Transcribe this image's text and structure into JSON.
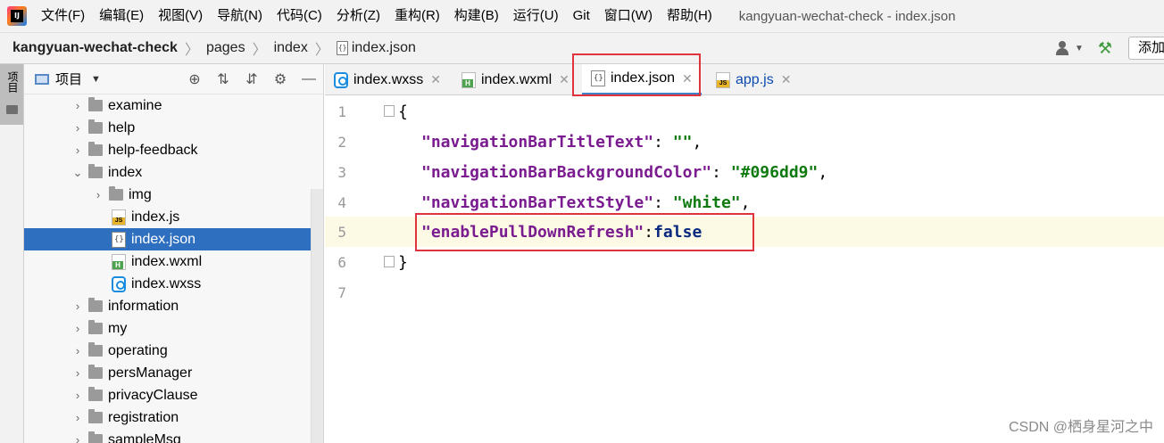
{
  "menubar": {
    "logo_icon": "jetbrains-ide-logo",
    "items": [
      "文件(F)",
      "编辑(E)",
      "视图(V)",
      "导航(N)",
      "代码(C)",
      "分析(Z)",
      "重构(R)",
      "构建(B)",
      "运行(U)",
      "Git",
      "窗口(W)",
      "帮助(H)"
    ],
    "window_title": "kangyuan-wechat-check - index.json"
  },
  "navbar": {
    "crumbs": [
      "kangyuan-wechat-check",
      "pages",
      "index",
      "index.json"
    ],
    "add_label": "添加"
  },
  "toolstrip": {
    "project_tab": "项目"
  },
  "project_panel": {
    "title": "项目",
    "tree": [
      {
        "label": "examine",
        "type": "folder",
        "expanded": false
      },
      {
        "label": "help",
        "type": "folder",
        "expanded": false
      },
      {
        "label": "help-feedback",
        "type": "folder",
        "expanded": false
      },
      {
        "label": "index",
        "type": "folder",
        "expanded": true
      },
      {
        "label": "img",
        "type": "folder",
        "expanded": false
      },
      {
        "label": "index.js",
        "type": "js"
      },
      {
        "label": "index.json",
        "type": "json",
        "selected": true
      },
      {
        "label": "index.wxml",
        "type": "wxml"
      },
      {
        "label": "index.wxss",
        "type": "wxss"
      },
      {
        "label": "information",
        "type": "folder",
        "expanded": false
      },
      {
        "label": "my",
        "type": "folder",
        "expanded": false
      },
      {
        "label": "operating",
        "type": "folder",
        "expanded": false
      },
      {
        "label": "persManager",
        "type": "folder",
        "expanded": false
      },
      {
        "label": "privacyClause",
        "type": "folder",
        "expanded": false
      },
      {
        "label": "registration",
        "type": "folder",
        "expanded": false
      },
      {
        "label": "sampleMsg",
        "type": "folder",
        "expanded": false
      }
    ]
  },
  "tabs": [
    {
      "label": "index.wxss",
      "icon": "wxss-file-icon"
    },
    {
      "label": "index.wxml",
      "icon": "wxml-file-icon"
    },
    {
      "label": "index.json",
      "icon": "json-file-icon",
      "active": true
    },
    {
      "label": "app.js",
      "icon": "js-file-icon"
    }
  ],
  "editor": {
    "line_numbers": [
      "1",
      "2",
      "3",
      "4",
      "5",
      "6",
      "7"
    ],
    "open_brace": "{",
    "close_brace": "}",
    "entries": [
      {
        "key": "\"navigationBarTitleText\"",
        "sep": ": ",
        "value": "\"\"",
        "tail": ","
      },
      {
        "key": "\"navigationBarBackgroundColor\"",
        "sep": ": ",
        "value": "\"#096dd9\"",
        "tail": ","
      },
      {
        "key": "\"navigationBarTextStyle\"",
        "sep": ": ",
        "value": "\"white\"",
        "tail": ","
      },
      {
        "key": "\"enablePullDownRefresh\"",
        "sep": ":",
        "value": "false",
        "tail": ""
      }
    ]
  },
  "watermark": "CSDN @栖身星河之中",
  "colors": {
    "selection": "#2f6fbf",
    "highlight_box": "#e0333c",
    "json_key": "#7a1c8f",
    "json_string": "#0f7a0f",
    "json_bool": "#0a2a80"
  }
}
